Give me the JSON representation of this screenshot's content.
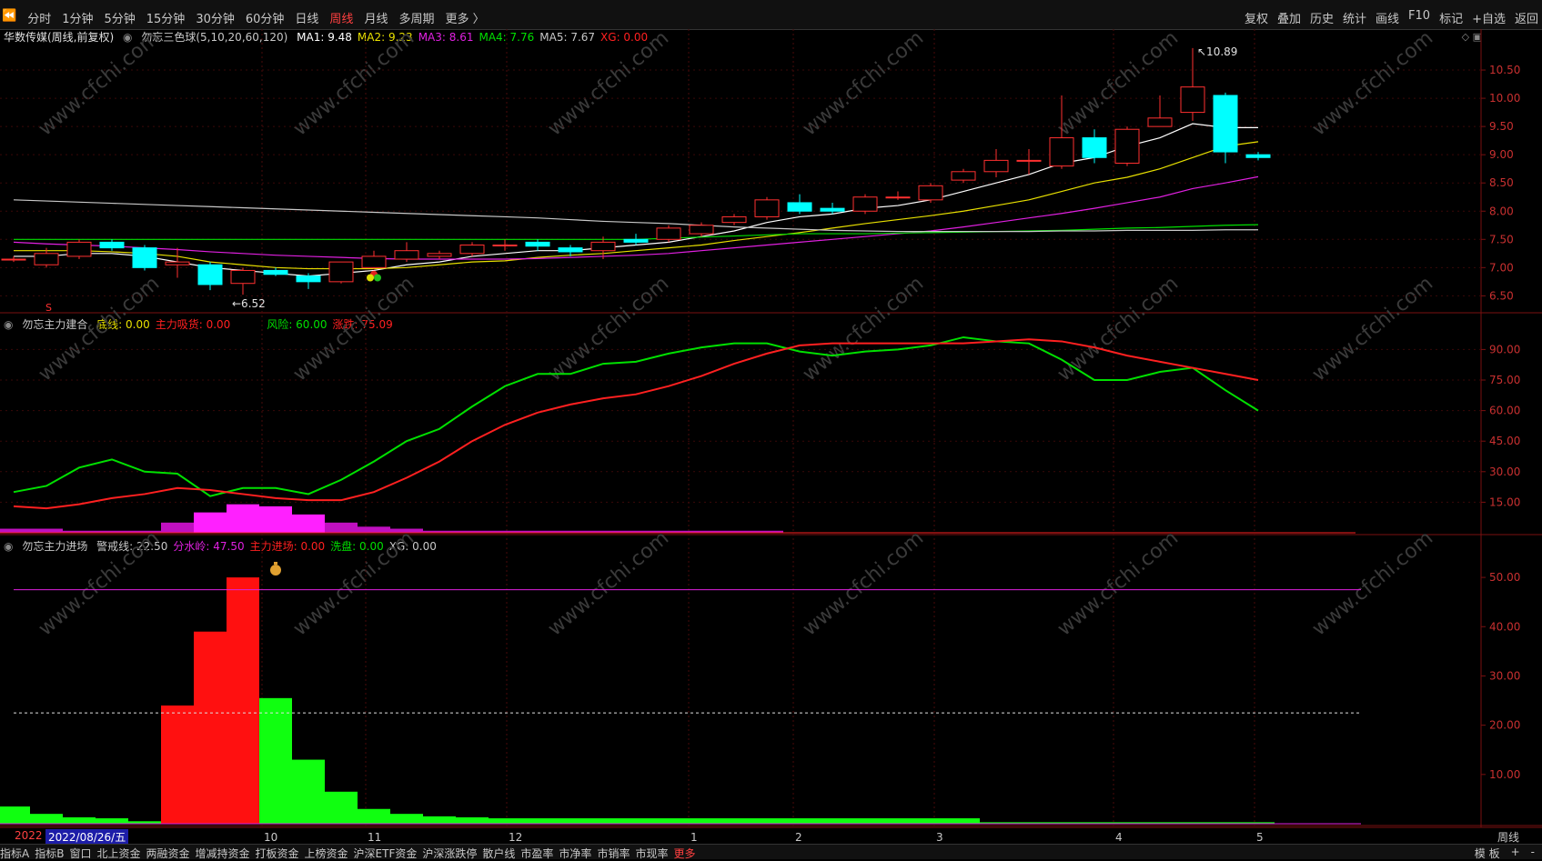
{
  "toolbar": {
    "back_symbol": "⏪",
    "periods": [
      "分时",
      "1分钟",
      "5分钟",
      "15分钟",
      "30分钟",
      "60分钟",
      "日线",
      "周线",
      "月线",
      "多周期",
      "更多 〉"
    ],
    "active_period": "周线",
    "right_tools": [
      "复权",
      "叠加",
      "历史",
      "统计",
      "画线",
      "F10",
      "标记",
      "+自选",
      "返回"
    ]
  },
  "main_panel": {
    "stock_title": "华数传媒(周线,前复权)",
    "indicator_name": "勿忘三色球(5,10,20,60,120)",
    "ma_values": [
      {
        "label": "MA1: 9.48",
        "color": "#ffffff"
      },
      {
        "label": "MA2: 9.23",
        "color": "#e8e000"
      },
      {
        "label": "MA3: 8.61",
        "color": "#e020e0"
      },
      {
        "label": "MA4: 7.76",
        "color": "#00e000"
      },
      {
        "label": "MA5: 7.67",
        "color": "#c8c8c8"
      },
      {
        "label": "XG: 0.00",
        "color": "#ff2020"
      }
    ],
    "high_label": "10.89",
    "low_label": "6.52",
    "s_marker": "S",
    "yaxis_ticks": [
      "10.50",
      "10.00",
      "9.50",
      "9.00",
      "8.50",
      "8.00",
      "7.50",
      "7.00",
      "6.50"
    ]
  },
  "panel2": {
    "name": "勿忘主力建合",
    "values": [
      {
        "label": "底线: 0.00",
        "color": "#e8e000"
      },
      {
        "label": "主力吸货: 0.00",
        "color": "#ff2020"
      },
      {
        "label": "风险: 60.00",
        "color": "#00e000"
      },
      {
        "label": "涨跌: 75.09",
        "color": "#ff2020"
      }
    ],
    "yaxis_ticks": [
      "90.00",
      "75.00",
      "60.00",
      "45.00",
      "30.00",
      "15.00"
    ]
  },
  "panel3": {
    "name": "勿忘主力进场",
    "values": [
      {
        "label": "警戒线: 22.50",
        "color": "#c8c8c8"
      },
      {
        "label": "分水岭: 47.50",
        "color": "#e020e0"
      },
      {
        "label": "主力进场: 0.00",
        "color": "#ff2020"
      },
      {
        "label": "洗盘: 0.00",
        "color": "#00e000"
      },
      {
        "label": "XG: 0.00",
        "color": "#c8c8c8"
      }
    ],
    "yaxis_ticks": [
      "50.00",
      "40.00",
      "30.00",
      "20.00",
      "10.00"
    ]
  },
  "xaxis": {
    "year_label": "2022",
    "cursor_date": "2022/08/26/五",
    "month_labels": [
      "10",
      "11",
      "12",
      "1",
      "2",
      "3",
      "4",
      "5"
    ]
  },
  "bottom_tabs": [
    "指标A",
    "指标B",
    "窗口",
    "北上资金",
    "两融资金",
    "增减持资金",
    "打板资金",
    "上榜资金",
    "沪深ETF资金",
    "沪深涨跌停",
    "散户线",
    "市盈率",
    "市净率",
    "市销率",
    "市现率",
    "更多"
  ],
  "bottom_right": [
    "模 板",
    "+",
    "-"
  ],
  "period_label": "周线",
  "watermark": "www.cfchi.com",
  "chart_data": [
    {
      "type": "candlestick",
      "title": "华数传媒(周线,前复权)",
      "ylim": [
        6.2,
        11.0
      ],
      "candles": [
        {
          "o": 7.15,
          "c": 7.15,
          "h": 7.2,
          "l": 7.1
        },
        {
          "o": 7.05,
          "c": 7.25,
          "h": 7.35,
          "l": 7.0
        },
        {
          "o": 7.2,
          "c": 7.45,
          "h": 7.5,
          "l": 7.15
        },
        {
          "o": 7.45,
          "c": 7.35,
          "h": 7.5,
          "l": 7.3
        },
        {
          "o": 7.35,
          "c": 7.0,
          "h": 7.4,
          "l": 6.95
        },
        {
          "o": 7.05,
          "c": 7.1,
          "h": 7.35,
          "l": 6.82
        },
        {
          "o": 7.05,
          "c": 6.7,
          "h": 7.1,
          "l": 6.6
        },
        {
          "o": 6.72,
          "c": 6.95,
          "h": 7.0,
          "l": 6.52
        },
        {
          "o": 6.95,
          "c": 6.88,
          "h": 7.0,
          "l": 6.85
        },
        {
          "o": 6.85,
          "c": 6.75,
          "h": 6.9,
          "l": 6.62
        },
        {
          "o": 6.75,
          "c": 7.1,
          "h": 7.1,
          "l": 6.72
        },
        {
          "o": 7.0,
          "c": 7.2,
          "h": 7.3,
          "l": 6.98
        },
        {
          "o": 7.15,
          "c": 7.3,
          "h": 7.45,
          "l": 7.1
        },
        {
          "o": 7.2,
          "c": 7.25,
          "h": 7.3,
          "l": 7.15
        },
        {
          "o": 7.25,
          "c": 7.4,
          "h": 7.45,
          "l": 7.2
        },
        {
          "o": 7.4,
          "c": 7.4,
          "h": 7.5,
          "l": 7.3
        },
        {
          "o": 7.45,
          "c": 7.38,
          "h": 7.5,
          "l": 7.3
        },
        {
          "o": 7.35,
          "c": 7.28,
          "h": 7.4,
          "l": 7.2
        },
        {
          "o": 7.3,
          "c": 7.45,
          "h": 7.55,
          "l": 7.15
        },
        {
          "o": 7.5,
          "c": 7.45,
          "h": 7.6,
          "l": 7.4
        },
        {
          "o": 7.5,
          "c": 7.7,
          "h": 7.75,
          "l": 7.45
        },
        {
          "o": 7.6,
          "c": 7.75,
          "h": 7.8,
          "l": 7.55
        },
        {
          "o": 7.8,
          "c": 7.9,
          "h": 7.95,
          "l": 7.75
        },
        {
          "o": 7.9,
          "c": 8.2,
          "h": 8.25,
          "l": 7.85
        },
        {
          "o": 8.15,
          "c": 8.0,
          "h": 8.3,
          "l": 7.95
        },
        {
          "o": 8.05,
          "c": 8.0,
          "h": 8.15,
          "l": 7.95
        },
        {
          "o": 8.0,
          "c": 8.25,
          "h": 8.3,
          "l": 7.95
        },
        {
          "o": 8.25,
          "c": 8.25,
          "h": 8.35,
          "l": 8.2
        },
        {
          "o": 8.2,
          "c": 8.45,
          "h": 8.5,
          "l": 8.15
        },
        {
          "o": 8.55,
          "c": 8.7,
          "h": 8.75,
          "l": 8.5
        },
        {
          "o": 8.7,
          "c": 8.9,
          "h": 9.1,
          "l": 8.6
        },
        {
          "o": 8.9,
          "c": 8.9,
          "h": 9.1,
          "l": 8.65
        },
        {
          "o": 8.8,
          "c": 9.3,
          "h": 10.05,
          "l": 8.75
        },
        {
          "o": 9.3,
          "c": 8.95,
          "h": 9.45,
          "l": 8.85
        },
        {
          "o": 8.85,
          "c": 9.45,
          "h": 9.5,
          "l": 8.8
        },
        {
          "o": 9.5,
          "c": 9.65,
          "h": 10.05,
          "l": 9.5
        },
        {
          "o": 9.75,
          "c": 10.2,
          "h": 10.89,
          "l": 9.6
        },
        {
          "o": 10.05,
          "c": 9.05,
          "h": 10.1,
          "l": 8.85
        },
        {
          "o": 9.0,
          "c": 8.95,
          "h": 9.05,
          "l": 8.9
        }
      ],
      "ma_series": [
        {
          "name": "MA1",
          "color": "#ffffff",
          "values": [
            7.2,
            7.2,
            7.25,
            7.25,
            7.2,
            7.1,
            7.0,
            6.95,
            6.9,
            6.85,
            6.9,
            6.95,
            7.05,
            7.1,
            7.2,
            7.25,
            7.3,
            7.3,
            7.35,
            7.4,
            7.45,
            7.55,
            7.65,
            7.8,
            7.9,
            7.95,
            8.05,
            8.1,
            8.2,
            8.35,
            8.5,
            8.65,
            8.85,
            8.95,
            9.15,
            9.3,
            9.55,
            9.48,
            9.48
          ]
        },
        {
          "name": "MA2",
          "color": "#e8e000",
          "values": [
            7.3,
            7.3,
            7.3,
            7.28,
            7.25,
            7.2,
            7.1,
            7.05,
            7.0,
            6.98,
            6.98,
            6.98,
            7.0,
            7.05,
            7.1,
            7.12,
            7.18,
            7.22,
            7.25,
            7.3,
            7.35,
            7.4,
            7.48,
            7.55,
            7.62,
            7.7,
            7.78,
            7.85,
            7.92,
            8.0,
            8.1,
            8.2,
            8.35,
            8.5,
            8.6,
            8.75,
            8.95,
            9.15,
            9.23
          ]
        },
        {
          "name": "MA3",
          "color": "#e020e0",
          "values": [
            7.45,
            7.42,
            7.4,
            7.38,
            7.35,
            7.32,
            7.28,
            7.25,
            7.22,
            7.2,
            7.18,
            7.16,
            7.15,
            7.15,
            7.15,
            7.15,
            7.16,
            7.18,
            7.2,
            7.22,
            7.25,
            7.3,
            7.35,
            7.4,
            7.45,
            7.5,
            7.55,
            7.6,
            7.65,
            7.72,
            7.8,
            7.88,
            7.96,
            8.05,
            8.15,
            8.25,
            8.4,
            8.5,
            8.61
          ]
        },
        {
          "name": "MA4",
          "color": "#00e000",
          "values": [
            7.5,
            7.5,
            7.5,
            7.5,
            7.5,
            7.5,
            7.5,
            7.5,
            7.5,
            7.5,
            7.5,
            7.5,
            7.5,
            7.5,
            7.5,
            7.5,
            7.5,
            7.5,
            7.5,
            7.5,
            7.52,
            7.54,
            7.56,
            7.58,
            7.6,
            7.6,
            7.6,
            7.61,
            7.62,
            7.63,
            7.64,
            7.65,
            7.66,
            7.68,
            7.7,
            7.71,
            7.73,
            7.75,
            7.76
          ]
        },
        {
          "name": "MA5",
          "color": "#c8c8c8",
          "values": [
            8.2,
            8.18,
            8.16,
            8.14,
            8.12,
            8.1,
            8.08,
            8.06,
            8.04,
            8.02,
            8.0,
            7.98,
            7.96,
            7.94,
            7.92,
            7.9,
            7.88,
            7.85,
            7.82,
            7.8,
            7.78,
            7.75,
            7.72,
            7.7,
            7.68,
            7.66,
            7.65,
            7.64,
            7.64,
            7.64,
            7.64,
            7.64,
            7.65,
            7.65,
            7.66,
            7.66,
            7.66,
            7.67,
            7.67
          ]
        }
      ]
    },
    {
      "type": "line",
      "title": "勿忘主力建合",
      "ylim": [
        0,
        100
      ],
      "series": [
        {
          "name": "风险",
          "color": "#00e000",
          "values": [
            20,
            23,
            32,
            36,
            30,
            29,
            18,
            22,
            22,
            19,
            26,
            35,
            45,
            51,
            62,
            72,
            78,
            78,
            83,
            84,
            88,
            91,
            93,
            93,
            89,
            87,
            89,
            90,
            92,
            96,
            94,
            93,
            85,
            75,
            75,
            79,
            81,
            70,
            60
          ]
        },
        {
          "name": "涨跌",
          "color": "#ff2020",
          "values": [
            13,
            12,
            14,
            17,
            19,
            22,
            21,
            19,
            17,
            16,
            16,
            20,
            27,
            35,
            45,
            53,
            59,
            63,
            66,
            68,
            72,
            77,
            83,
            88,
            92,
            93,
            93,
            93,
            93,
            93,
            94,
            95,
            94,
            91,
            87,
            84,
            81,
            78,
            75
          ]
        }
      ],
      "histogram": [
        2,
        2,
        1,
        1,
        1,
        5,
        10,
        14,
        13,
        9,
        5,
        3,
        2,
        1,
        1,
        1,
        1,
        1,
        1,
        1,
        1,
        1,
        1,
        1,
        0,
        0,
        0,
        0,
        0,
        0,
        0,
        0,
        0,
        0,
        0,
        0,
        0,
        0,
        0
      ]
    },
    {
      "type": "bar",
      "title": "勿忘主力进场",
      "ylim": [
        0,
        55
      ],
      "warning_line": 22.5,
      "divide_line": 47.5,
      "bars": [
        {
          "v": 3.5,
          "c": "green"
        },
        {
          "v": 2,
          "c": "green"
        },
        {
          "v": 1.3,
          "c": "green"
        },
        {
          "v": 1.1,
          "c": "green"
        },
        {
          "v": 0.5,
          "c": "green"
        },
        {
          "v": 24,
          "c": "red"
        },
        {
          "v": 39,
          "c": "red"
        },
        {
          "v": 50,
          "c": "red"
        },
        {
          "v": 25.5,
          "c": "green"
        },
        {
          "v": 13,
          "c": "green"
        },
        {
          "v": 6.5,
          "c": "green"
        },
        {
          "v": 3,
          "c": "green"
        },
        {
          "v": 2,
          "c": "green"
        },
        {
          "v": 1.5,
          "c": "green"
        },
        {
          "v": 1.3,
          "c": "green"
        },
        {
          "v": 1.1,
          "c": "green"
        },
        {
          "v": 1.1,
          "c": "green"
        },
        {
          "v": 1.1,
          "c": "green"
        },
        {
          "v": 1.1,
          "c": "green"
        },
        {
          "v": 1.1,
          "c": "green"
        },
        {
          "v": 1.1,
          "c": "green"
        },
        {
          "v": 1.1,
          "c": "green"
        },
        {
          "v": 1.1,
          "c": "green"
        },
        {
          "v": 1.1,
          "c": "green"
        },
        {
          "v": 1.1,
          "c": "green"
        },
        {
          "v": 1.1,
          "c": "green"
        },
        {
          "v": 1.1,
          "c": "green"
        },
        {
          "v": 1.1,
          "c": "green"
        },
        {
          "v": 1.1,
          "c": "green"
        },
        {
          "v": 1.1,
          "c": "green"
        },
        {
          "v": 0.3,
          "c": "green"
        },
        {
          "v": 0.3,
          "c": "green"
        },
        {
          "v": 0.3,
          "c": "green"
        },
        {
          "v": 0.3,
          "c": "green"
        },
        {
          "v": 0.3,
          "c": "green"
        },
        {
          "v": 0.3,
          "c": "green"
        },
        {
          "v": 0.3,
          "c": "green"
        },
        {
          "v": 0.3,
          "c": "green"
        },
        {
          "v": 0.3,
          "c": "green"
        }
      ]
    }
  ]
}
